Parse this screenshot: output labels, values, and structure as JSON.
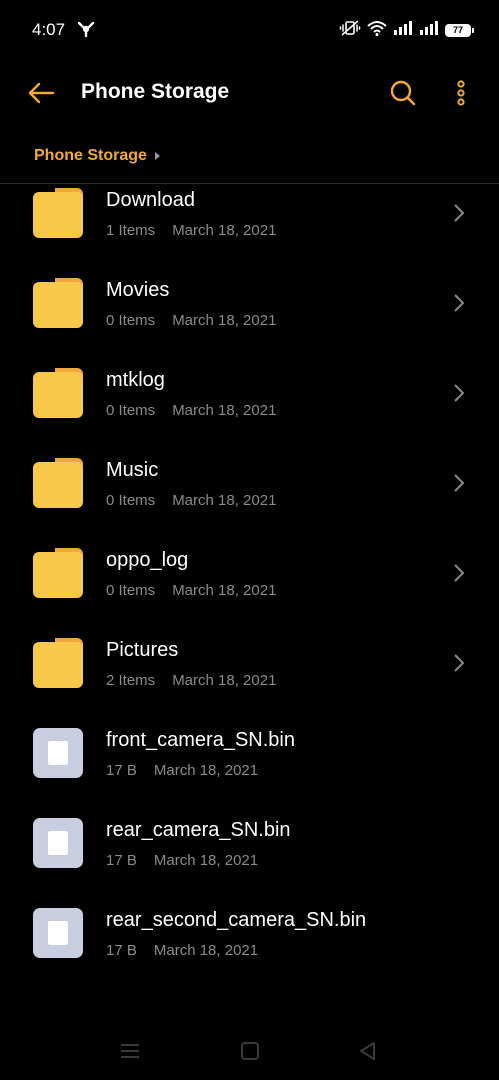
{
  "status_bar": {
    "time": "4:07",
    "battery": "77"
  },
  "app_bar": {
    "title": "Phone Storage"
  },
  "breadcrumb": {
    "label": "Phone Storage"
  },
  "colors": {
    "accent": "#f3a935",
    "folder": "#f8c84b",
    "file_tile": "#c8cde0",
    "meta_text": "#8a8a8a",
    "background": "#000000"
  },
  "icons": {
    "back": "arrow-left-icon",
    "search": "search-icon",
    "more": "more-vertical-icon",
    "folder": "folder-icon",
    "file": "file-icon",
    "chevron": "chevron-right-icon"
  },
  "items": [
    {
      "name": "Download",
      "count": "1 Items",
      "date": "March 18, 2021",
      "type": "folder"
    },
    {
      "name": "Movies",
      "count": "0 Items",
      "date": "March 18, 2021",
      "type": "folder"
    },
    {
      "name": "mtklog",
      "count": "0 Items",
      "date": "March 18, 2021",
      "type": "folder"
    },
    {
      "name": "Music",
      "count": "0 Items",
      "date": "March 18, 2021",
      "type": "folder"
    },
    {
      "name": "oppo_log",
      "count": "0 Items",
      "date": "March 18, 2021",
      "type": "folder"
    },
    {
      "name": "Pictures",
      "count": "2 Items",
      "date": "March 18, 2021",
      "type": "folder"
    },
    {
      "name": "front_camera_SN.bin",
      "count": "17 B",
      "date": "March 18, 2021",
      "type": "file"
    },
    {
      "name": "rear_camera_SN.bin",
      "count": "17 B",
      "date": "March 18, 2021",
      "type": "file"
    },
    {
      "name": "rear_second_camera_SN.bin",
      "count": "17 B",
      "date": "March 18, 2021",
      "type": "file"
    }
  ]
}
